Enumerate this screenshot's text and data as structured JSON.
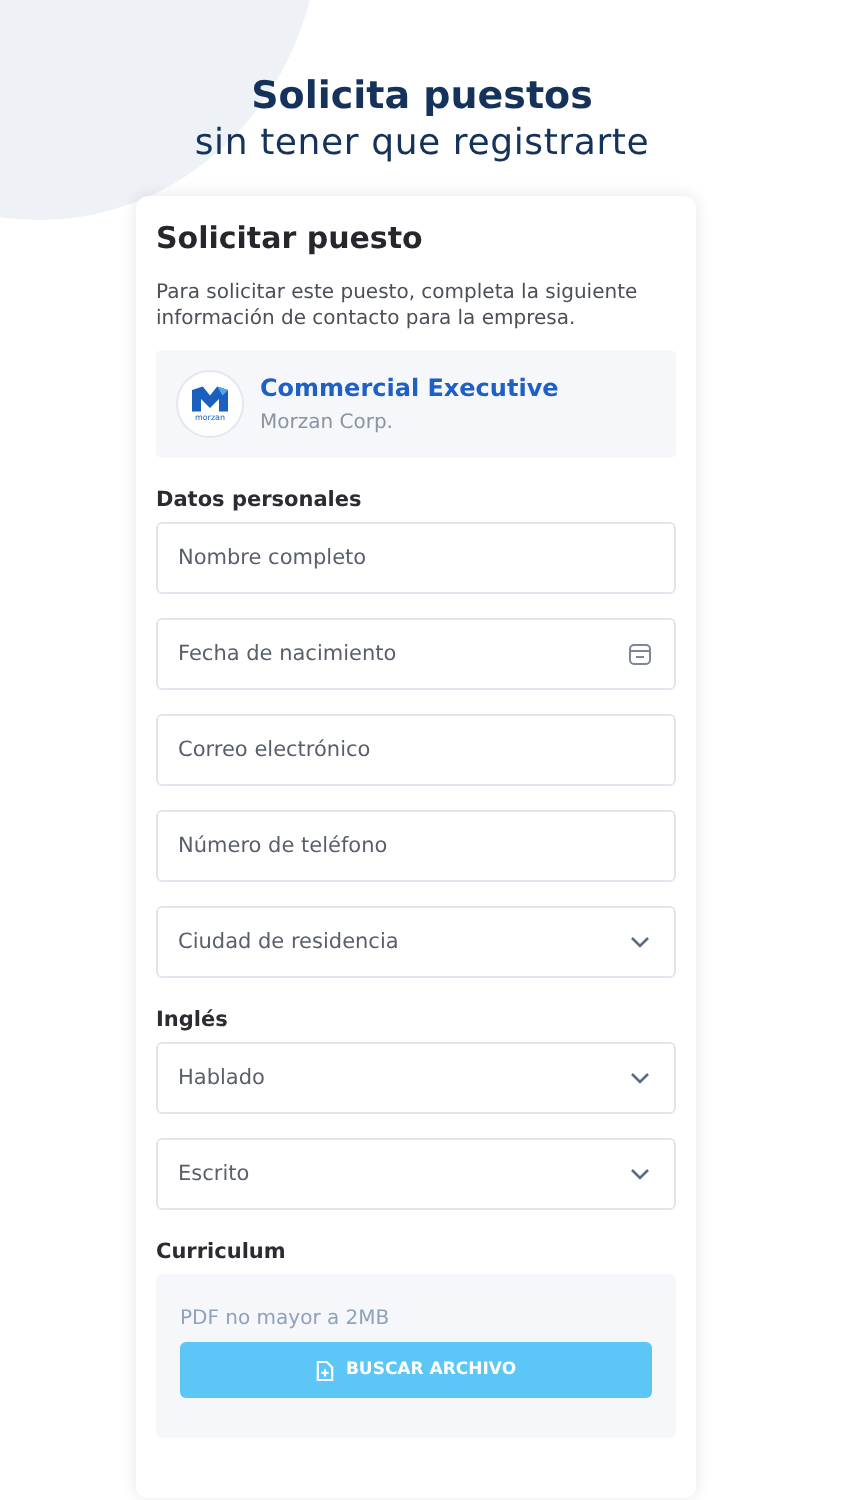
{
  "header": {
    "title": "Solicita puestos",
    "subtitle": "sin tener que registrarte"
  },
  "card": {
    "title": "Solicitar puesto",
    "description": "Para solicitar este puesto, completa la siguiente información de contacto para la empresa.",
    "job": {
      "logo_text": "morzan",
      "title": "Commercial Executive",
      "company": "Morzan Corp."
    },
    "sections": [
      {
        "title": "Datos personales",
        "fields": [
          {
            "kind": "text",
            "placeholder": "Nombre completo"
          },
          {
            "kind": "date",
            "placeholder": "Fecha de nacimiento"
          },
          {
            "kind": "text",
            "placeholder": "Correo electrónico"
          },
          {
            "kind": "text",
            "placeholder": "Número de teléfono"
          },
          {
            "kind": "select",
            "placeholder": "Ciudad de residencia"
          }
        ]
      },
      {
        "title": "Inglés",
        "fields": [
          {
            "kind": "select",
            "placeholder": "Hablado"
          },
          {
            "kind": "select",
            "placeholder": "Escrito"
          }
        ]
      }
    ],
    "upload": {
      "title": "Curriculum",
      "hint": "PDF no mayor a 2MB",
      "button": "BUSCAR ARCHIVO"
    }
  }
}
